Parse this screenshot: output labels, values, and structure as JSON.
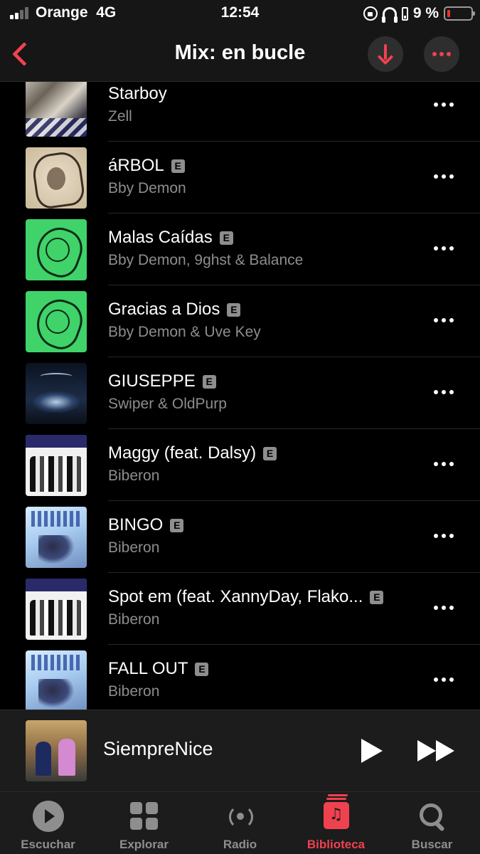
{
  "status_bar": {
    "carrier": "Orange",
    "network": "4G",
    "time": "12:54",
    "battery_percent": "9 %",
    "battery_level": 0.09
  },
  "header": {
    "title": "Mix: en bucle",
    "accent_color": "#f0414f"
  },
  "explicit_badge": "E",
  "tracks": [
    {
      "title": "Starboy",
      "artist": "Zell",
      "explicit": false,
      "art": "photo"
    },
    {
      "title": "áRBOL",
      "artist": "Bby Demon",
      "explicit": true,
      "art": "sketch"
    },
    {
      "title": "Malas Caídas",
      "artist": "Bby Demon, 9ghst & Balance",
      "explicit": true,
      "art": "green"
    },
    {
      "title": "Gracias a Dios",
      "artist": "Bby Demon & Uve Key",
      "explicit": true,
      "art": "green"
    },
    {
      "title": "GIUSEPPE",
      "artist": "Swiper & OldPurp",
      "explicit": true,
      "art": "dark"
    },
    {
      "title": "Maggy (feat. Dalsy)",
      "artist": "Biberon",
      "explicit": true,
      "art": "bottles"
    },
    {
      "title": "BINGO",
      "artist": "Biberon",
      "explicit": true,
      "art": "blue"
    },
    {
      "title": "Spot em (feat. XannyDay, Flako...",
      "artist": "Biberon",
      "explicit": true,
      "art": "bottles"
    },
    {
      "title": "FALL OUT",
      "artist": "Biberon",
      "explicit": true,
      "art": "blue"
    }
  ],
  "player": {
    "title": "SiempreNice"
  },
  "tabs": [
    {
      "label": "Escuchar",
      "icon": "play-circle-icon",
      "active": false
    },
    {
      "label": "Explorar",
      "icon": "grid-icon",
      "active": false
    },
    {
      "label": "Radio",
      "icon": "radio-icon",
      "active": false
    },
    {
      "label": "Biblioteca",
      "icon": "library-icon",
      "active": true
    },
    {
      "label": "Buscar",
      "icon": "search-icon",
      "active": false
    }
  ]
}
